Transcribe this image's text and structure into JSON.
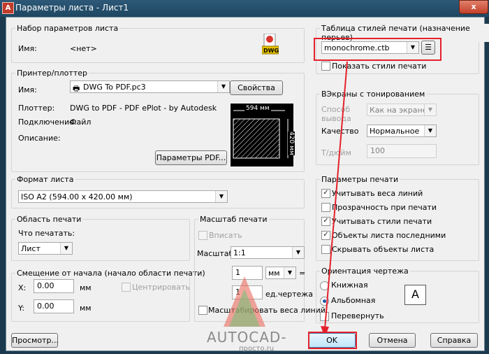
{
  "window": {
    "title": "Параметры листа - Лист1",
    "app_icon": "A",
    "close_glyph": "x"
  },
  "page_setup": {
    "group": "Набор параметров листа",
    "name_label": "Имя:",
    "name_value": "<нет>",
    "dwg_icon_text": "DWG"
  },
  "printer": {
    "group": "Принтер/плоттер",
    "name_label": "Имя:",
    "name_value": "DWG To PDF.pc3",
    "properties_button": "Свойства",
    "plotter_label": "Плоттер:",
    "plotter_value": "DWG to PDF - PDF ePlot - by Autodesk",
    "connection_label": "Подключение:",
    "connection_value": "Файл",
    "description_label": "Описание:",
    "pdf_options_button": "Параметры PDF...",
    "preview_width": "594 мм",
    "preview_height": "420 мм"
  },
  "paper_size": {
    "group": "Формат листа",
    "value": "ISO A2 (594.00 x 420.00 мм)"
  },
  "plot_area": {
    "group": "Область печати",
    "what_label": "Что печатать:",
    "what_value": "Лист"
  },
  "plot_offset": {
    "group": "Смещение от начала (начало области печати)",
    "x_label": "X:",
    "x_value": "0.00",
    "x_unit": "мм",
    "y_label": "Y:",
    "y_value": "0.00",
    "y_unit": "мм",
    "center_label": "Центрировать"
  },
  "plot_scale": {
    "group": "Масштаб печати",
    "fit_label": "Вписать",
    "scale_label": "Масштаб:",
    "scale_value": "1:1",
    "value1": "1",
    "unit_value": "мм",
    "equals": "=",
    "value2": "1",
    "unit2_label": "ед.чертежа",
    "scale_lineweights_label": "Масштабировать веса линий"
  },
  "plot_style": {
    "group": "Таблица стилей печати (назначение перьев)",
    "value": "monochrome.ctb",
    "show_label": "Показать стили печати"
  },
  "shaded": {
    "group": "ВЭкраны с тонированием",
    "method_label": "Способ вывода",
    "method_value": "Как на экране",
    "quality_label": "Качество",
    "quality_value": "Нормальное",
    "dpi_label": "Т/дюйм",
    "dpi_value": "100"
  },
  "plot_options": {
    "group": "Параметры печати",
    "items": [
      {
        "label": "Учитывать веса линий",
        "checked": true
      },
      {
        "label": "Прозрачность при печати",
        "checked": false
      },
      {
        "label": "Учитывать стили печати",
        "checked": true
      },
      {
        "label": "Объекты листа последними",
        "checked": true
      },
      {
        "label": "Скрывать объекты листа",
        "checked": false
      }
    ]
  },
  "orientation": {
    "group": "Ориентация чертежа",
    "portrait": "Книжная",
    "landscape": "Альбомная",
    "upside_down": "Перевернуть",
    "icon_letter": "A"
  },
  "buttons": {
    "preview": "Просмотр...",
    "ok": "OK",
    "cancel": "Отмена",
    "help": "Справка"
  },
  "watermark": {
    "text": "AUTOCAD-",
    "sub": "просто.ru"
  },
  "colors": {
    "highlight": "#e4212b",
    "title_bar": "#1e4762"
  }
}
